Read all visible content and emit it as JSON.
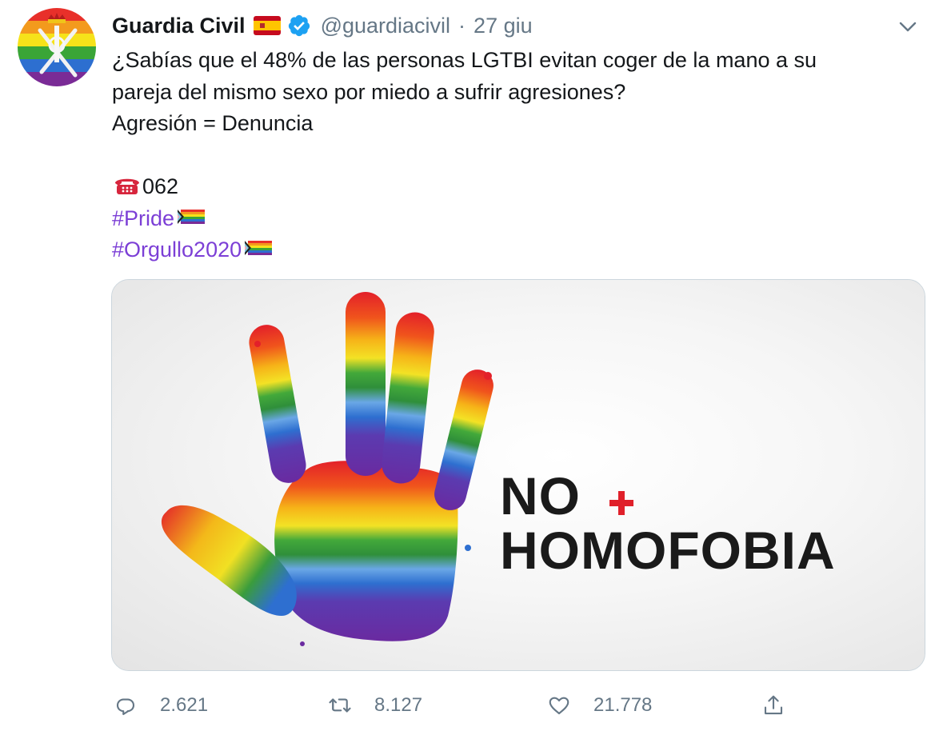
{
  "tweet": {
    "author": {
      "name": "Guardia Civil",
      "handle": "@guardiacivil",
      "verified": true,
      "flag_icon": "spain-flag-icon",
      "avatar_icon": "guardia-civil-rainbow-emblem"
    },
    "separator": "·",
    "date": "27 giu",
    "text": {
      "line1": "¿Sabías que el 48% de las personas LGTBI evitan coger de la mano a su",
      "line2": "pareja del mismo sexo por miedo a sufrir agresiones?",
      "line3": "Agresión = Denuncia",
      "phone_icon": "telephone-icon",
      "phone_number": "062",
      "hashtag1": "#Pride",
      "hashtag2": "#Orgullo2020",
      "flag_emoji": "progress-pride-flag-icon"
    },
    "media": {
      "line1": "NO",
      "line2": "HOMOFOBIA",
      "plus_color": "#e0202a"
    },
    "actions": {
      "replies": "2.621",
      "retweets": "8.127",
      "likes": "21.778"
    },
    "colors": {
      "hashtag": "#7c3fd6",
      "muted": "#657786",
      "verified": "#1da1f2"
    }
  }
}
